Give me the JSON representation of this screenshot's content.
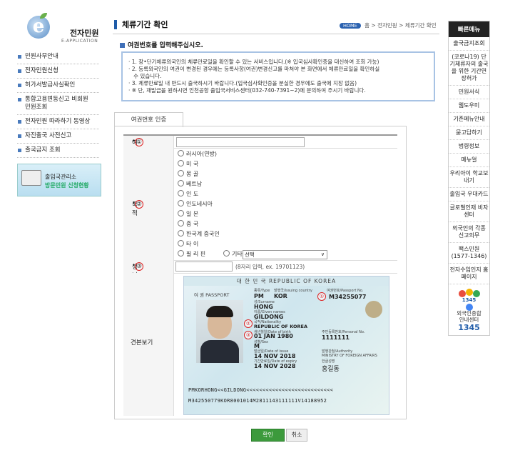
{
  "logo": {
    "title": "전자민원",
    "subtitle": "E-APPLICATION"
  },
  "left_nav": {
    "items": [
      "민원사무안내",
      "전자민원신청",
      "허가서발급사실확인",
      "통합고용변동신고 비회원 민원조회",
      "전자민원 따라하기 동영상",
      "자진출국 사전신고",
      "출국금지 조회"
    ]
  },
  "banner": {
    "line1": "출입국관리소",
    "line2": "방문민원 신청현황"
  },
  "header": {
    "title": "체류기간 확인",
    "home_badge": "HOME",
    "breadcrumb": [
      "홈",
      "전자민원",
      "체류기간 확인"
    ],
    "sep": ">"
  },
  "subtitle": "여권번호를 입력해주십시오.",
  "notice": [
    "· 1. 장•단기체류외국인의 체류만료일을 확인할 수 있는 서비스입니다.(※ 입국심사확인증을 대신하여 조회 가능)",
    "· 2. 등록외국인의 여권이 변경된 경우에는 등록사항(여권)변경신고를 마쳐야 본 화면에서 체류만료일을 확인하실",
    "   수 있습니다.",
    "· 3. 체류만료일 내 반드시 출국하시기 바랍니다.(입국심사확인증을 분실한 경우에도 출국에 지장 없음)",
    "· ※ 단, 재발급을 원하시면 인천공항 출입국서비스센터(032-740-7391~2)에 문의하여 주시기 바랍니다."
  ],
  "tab": {
    "label": "여권번호 인증"
  },
  "form": {
    "required_mark": "•",
    "passport": {
      "label": "여권번호",
      "num": "①",
      "value": ""
    },
    "nationality": {
      "label": "국적",
      "num": "②",
      "options": [
        "러시아(연방)",
        "미 국",
        "몽 골",
        "베트남",
        "인 도",
        "인도네시아",
        "일 본",
        "중 국",
        "한국계 중국인",
        "타 이",
        "필 리 핀"
      ],
      "other_label": "기타",
      "select_value": "선택",
      "select_arrow": "∨"
    },
    "birth": {
      "label": "생년월일",
      "num": "③",
      "value": "",
      "hint": "(8자리 입력, ex. 19701123)"
    },
    "sample": {
      "label": "견본보기",
      "header": "대 한 민 국   REPUBLIC OF KOREA",
      "type_label": "여 권  PASSPORT",
      "small_labels": [
        "종류/Type",
        "발행국/Issuing country",
        "여권번호/Passport No.",
        "성/Surname",
        "이름/Given names",
        "국적/Nationality",
        "생년월일/Date of birth",
        "주민등록번호/Personal No.",
        "성별/Sex",
        "발급일/Date of issue",
        "발행관청/Authority",
        "기간만료일/Date of expiry",
        "한글성명"
      ],
      "type": "PM",
      "country": "KOR",
      "passport_no": "M34255077",
      "surname": "HONG",
      "given": "GILDONG",
      "nationality": "REPUBLIC OF KOREA",
      "dob": "01 JAN 1980",
      "personal": "1111111",
      "sex": "M",
      "issue": "14 NOV 2018",
      "authority": "MINISTRY OF FOREIGN AFFAIRS",
      "expiry": "14 NOV 2028",
      "korean_name": "홍길동",
      "mrz1": "PMKORHONG<<GILDONG<<<<<<<<<<<<<<<<<<<<<<<<<<<",
      "mrz2": "M342550779KOR8001014M2811143111111V14188952",
      "marks": [
        "①",
        "②",
        "③"
      ]
    }
  },
  "buttons": {
    "ok": "확인",
    "cancel": "취소"
  },
  "quick_menu": {
    "title": "빠른메뉴",
    "items": [
      "출국금지조회",
      "(코로나19) 단기체류자의 출국을 위한 기간연장허가",
      "민원서식",
      "웹도우미",
      "기존메뉴안내",
      "묻고답하기",
      "법령정보",
      "메뉴얼",
      "우리아이 학교보내기",
      "출입국 우대카드",
      "글로벌인재 비자센터",
      "외국인의 각종 신고의무",
      "팩스민원 (1577-1346)",
      "전자수입인지 홈페이지"
    ],
    "call": {
      "line1": "외국인종합",
      "line2": "안내센터",
      "number": "1345",
      "logo_text": "1345"
    }
  },
  "colors": {
    "accent": "#1e5ba8",
    "ok_button": "#3c9a3c",
    "required": "#dd2222"
  }
}
